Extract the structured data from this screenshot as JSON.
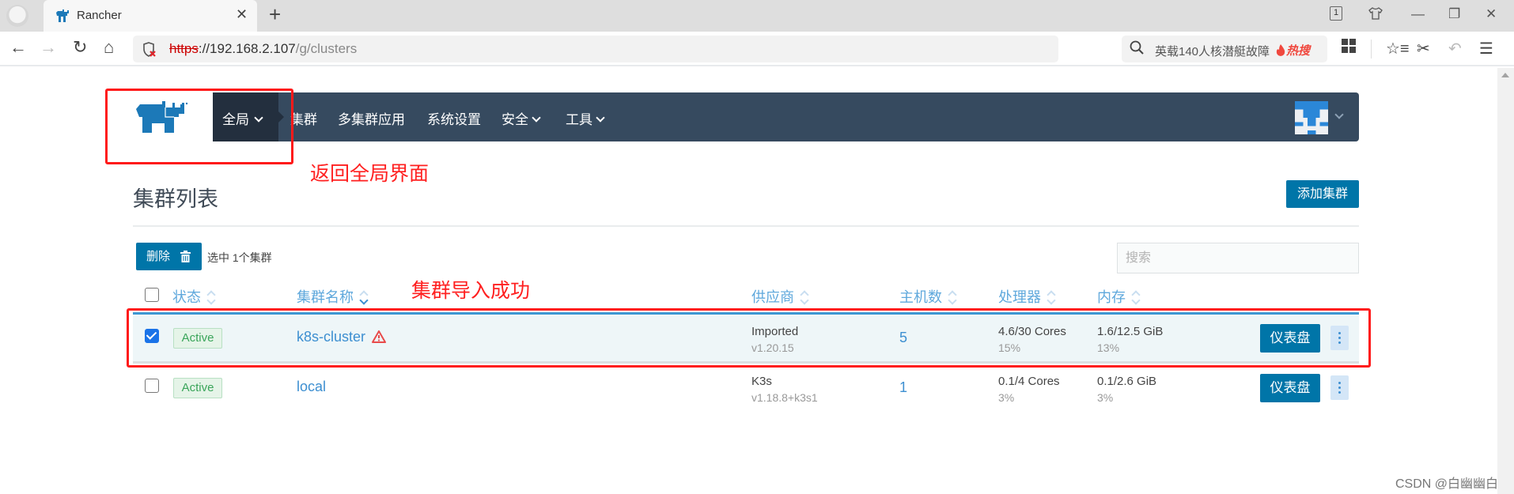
{
  "browser": {
    "tab_title": "Rancher",
    "tab_count": "1",
    "url_protocol": "https",
    "url_host": "://192.168.2.107",
    "url_path": "/g/clusters",
    "search_text": "英载140人核潜艇故障",
    "hot_label": "热搜",
    "icons": {
      "back": "arrow-left-icon",
      "forward": "arrow-right-icon",
      "reload": "reload-icon",
      "home": "home-icon",
      "close_tab": "close-icon",
      "new_tab": "plus-icon",
      "security": "shield-warning-icon",
      "bookmark": "star-icon",
      "more": "more-dots-icon",
      "search": "search-icon",
      "apps": "grid-icon",
      "favorites": "star-list-icon",
      "screenshot": "scissors-icon",
      "undo": "undo-icon",
      "menu": "hamburger-icon"
    },
    "glyphs": {
      "back": "←",
      "forward": "→",
      "reload": "↻",
      "home": "⌂",
      "close_tab": "✕",
      "new_tab": "+",
      "bookmark": "☆",
      "more": "···",
      "apps": "▦",
      "favorites": "☆≡",
      "screenshot": "✂",
      "undo": "↶",
      "menu": "☰",
      "skin": "👕",
      "minimize": "—",
      "restore": "❐",
      "close_window": "✕"
    }
  },
  "rancher": {
    "nav": {
      "global_label": "全局",
      "items": [
        {
          "label": "集群"
        },
        {
          "label": "多集群应用"
        },
        {
          "label": "系统设置"
        },
        {
          "label": "安全",
          "dropdown": true
        },
        {
          "label": "工具",
          "dropdown": true
        }
      ]
    },
    "page": {
      "title": "集群列表",
      "add_cluster_label": "添加集群",
      "delete_label": "删除",
      "selected_info": "选中 1个集群",
      "search_placeholder": "搜索"
    },
    "table": {
      "columns": {
        "state": "状态",
        "name": "集群名称",
        "provider": "供应商",
        "nodes": "主机数",
        "cpu": "处理器",
        "memory": "内存"
      },
      "rows": [
        {
          "selected": true,
          "state": "Active",
          "name": "k8s-cluster",
          "warning": true,
          "provider": "Imported",
          "version": "v1.20.15",
          "nodes": "5",
          "cpu": "4.6/30 Cores",
          "cpu_pct": "15%",
          "memory": "1.6/12.5 GiB",
          "memory_pct": "13%",
          "dashboard_label": "仪表盘"
        },
        {
          "selected": false,
          "state": "Active",
          "name": "local",
          "warning": false,
          "provider": "K3s",
          "version": "v1.18.8+k3s1",
          "nodes": "1",
          "cpu": "0.1/4 Cores",
          "cpu_pct": "3%",
          "memory": "0.1/2.6 GiB",
          "memory_pct": "3%",
          "dashboard_label": "仪表盘"
        }
      ]
    }
  },
  "annotations": {
    "global_note": "返回全局界面",
    "import_note": "集群导入成功",
    "color": "#ff2020"
  },
  "watermark": "CSDN @白幽幽白",
  "colors": {
    "navbar": "#364a5f",
    "navbar_active": "#232f3e",
    "primary": "#0075a8",
    "link": "#3d8fd1",
    "active_badge": "#3aa55a"
  }
}
